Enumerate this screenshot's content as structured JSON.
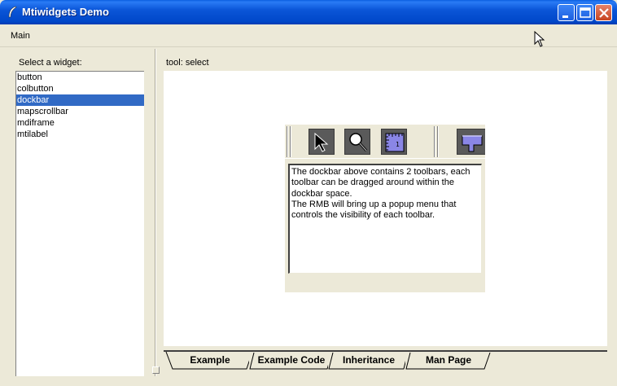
{
  "window": {
    "title": "Mtiwidgets Demo",
    "minimize_icon": "minimize-icon",
    "maximize_icon": "maximize-icon",
    "close_icon": "close-icon"
  },
  "menubar": {
    "items": [
      {
        "label": "Main"
      }
    ]
  },
  "left": {
    "label": "Select a widget:",
    "widgets": [
      "button",
      "colbutton",
      "dockbar",
      "mapscrollbar",
      "mdiframe",
      "mtilabel"
    ],
    "selected": "dockbar"
  },
  "right": {
    "status": "tool: select"
  },
  "dockbar_demo": {
    "tools": [
      "arrow-pointer-icon",
      "magnifier-icon",
      "ruler-icon",
      "toolbar-shape-icon"
    ],
    "text": "The dockbar above contains 2 toolbars, each toolbar can be dragged around within the dockbar space.\nThe RMB will bring up a popup menu that controls the visibility of each toolbar."
  },
  "tabs": [
    {
      "label": "Example",
      "active": true
    },
    {
      "label": "Example Code",
      "active": false
    },
    {
      "label": "Inheritance",
      "active": false
    },
    {
      "label": "Man Page",
      "active": false
    }
  ],
  "colors": {
    "title_bar": "#0a5fe0",
    "selection": "#316ac5",
    "window_bg": "#ece9d8",
    "tool_accent": "#8a86e6"
  }
}
